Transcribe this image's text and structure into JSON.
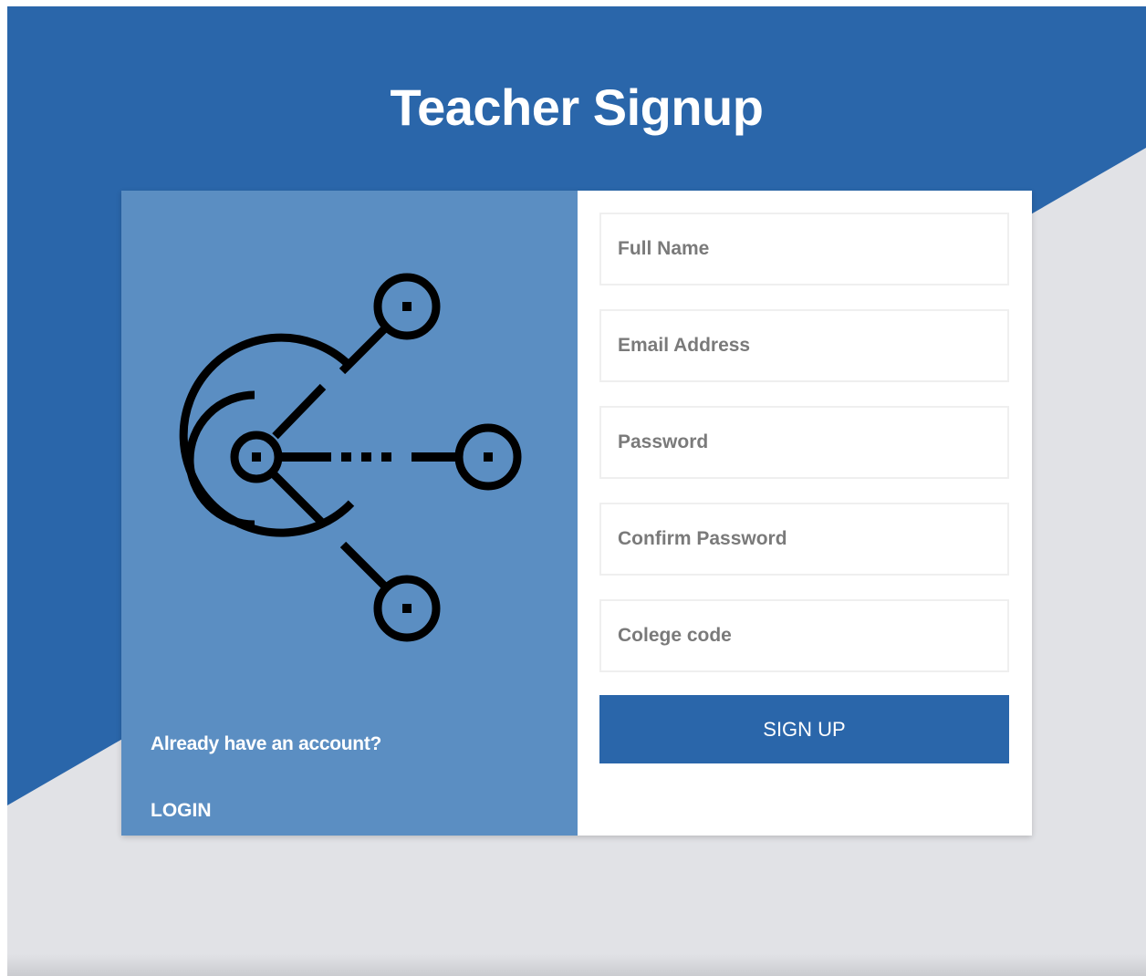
{
  "page": {
    "title": "Teacher Signup"
  },
  "left_panel": {
    "icon": "network-nodes-icon",
    "account_prompt": "Already have an account?",
    "login_label": "LOGIN"
  },
  "form": {
    "full_name": {
      "placeholder": "Full Name",
      "value": ""
    },
    "email": {
      "placeholder": "Email Address",
      "value": ""
    },
    "password": {
      "placeholder": "Password",
      "value": ""
    },
    "confirm_password": {
      "placeholder": "Confirm Password",
      "value": ""
    },
    "college_code": {
      "placeholder": "Colege code",
      "value": ""
    },
    "submit_label": "SIGN UP"
  },
  "colors": {
    "primary_blue": "#2a66aa",
    "panel_blue": "#5b8ec2",
    "background_gray": "#e1e2e6",
    "placeholder_gray": "#7a7a7a",
    "icon_stroke": "#000000"
  }
}
